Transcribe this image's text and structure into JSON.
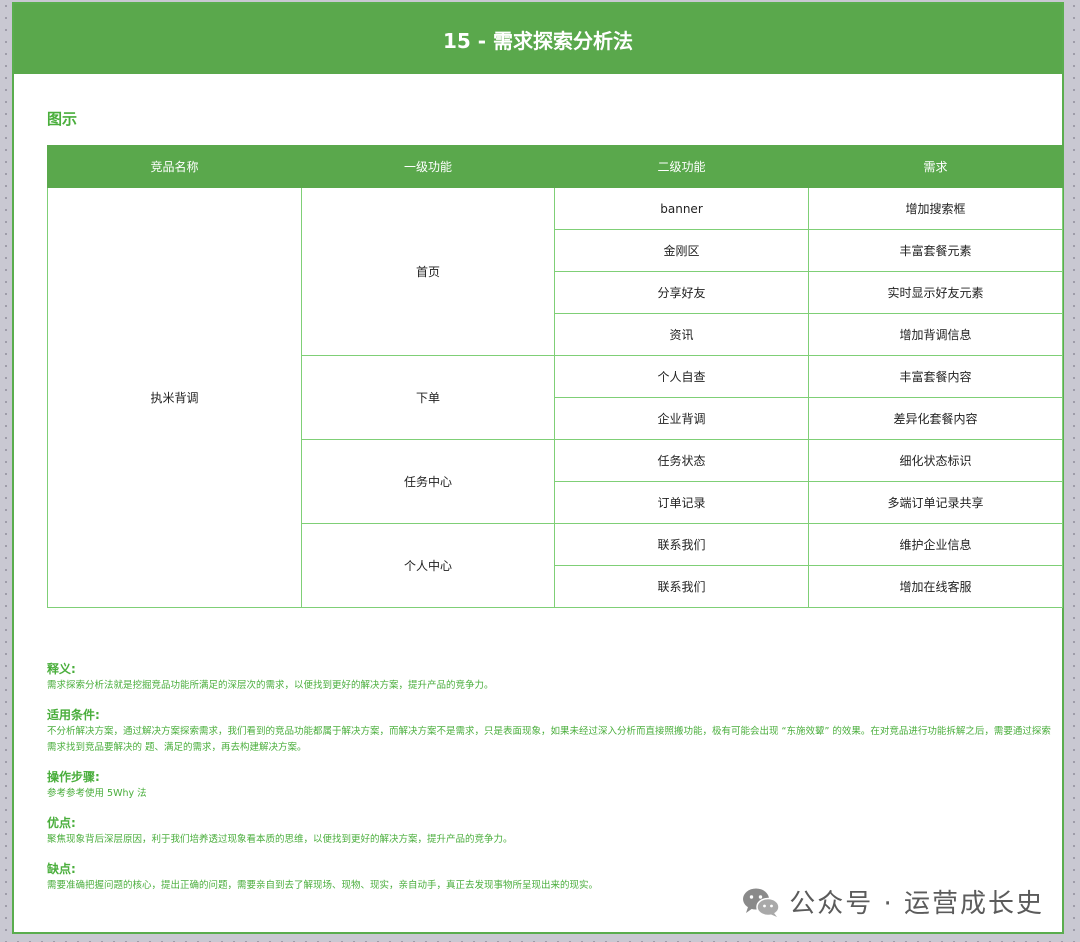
{
  "header": {
    "title": "15 - 需求探索分析法"
  },
  "section": {
    "title": "图示"
  },
  "table": {
    "headers": [
      "竞品名称",
      "一级功能",
      "二级功能",
      "需求"
    ],
    "product": "执米背调",
    "groups": [
      {
        "level1": "首页",
        "rows": [
          {
            "level2": "banner",
            "need": "增加搜索框"
          },
          {
            "level2": "金刚区",
            "need": "丰富套餐元素"
          },
          {
            "level2": "分享好友",
            "need": "实时显示好友元素"
          },
          {
            "level2": "资讯",
            "need": "增加背调信息"
          }
        ]
      },
      {
        "level1": "下单",
        "rows": [
          {
            "level2": "个人自查",
            "need": "丰富套餐内容"
          },
          {
            "level2": "企业背调",
            "need": "差异化套餐内容"
          }
        ]
      },
      {
        "level1": "任务中心",
        "rows": [
          {
            "level2": "任务状态",
            "need": "细化状态标识"
          },
          {
            "level2": "订单记录",
            "need": "多端订单记录共享"
          }
        ]
      },
      {
        "level1": "个人中心",
        "rows": [
          {
            "level2": "联系我们",
            "need": "维护企业信息"
          },
          {
            "level2": "联系我们",
            "need": "增加在线客服"
          }
        ]
      }
    ]
  },
  "notes": {
    "definition": {
      "title": "释义:",
      "body": "需求探索分析法就是挖掘竞品功能所满足的深层次的需求，以便找到更好的解决方案，提升产品的竞争力。"
    },
    "conditions": {
      "title": "适用条件:",
      "body": "不分析解决方案，通过解决方案探索需求，我们看到的竞品功能都属于解决方案，而解决方案不是需求，只是表面现象，如果未经过深入分析而直接照搬功能，极有可能会出现 “东施效颦” 的效果。在对竞品进行功能拆解之后，需要通过探索需求找到竞品要解决的 题、满足的需求，再去构建解决方案。"
    },
    "steps": {
      "title": "操作步骤:",
      "body": "参考参考使用 5Why 法"
    },
    "pros": {
      "title": "优点:",
      "body": "聚焦现象背后深层原因，利于我们培养透过现象看本质的思维，以便找到更好的解决方案，提升产品的竞争力。"
    },
    "cons": {
      "title": "缺点:",
      "body": "需要准确把握问题的核心，提出正确的问题，需要亲自到去了解现场、现物、现实，亲自动手，真正去发现事物所呈现出来的现实。"
    }
  },
  "watermark": {
    "text": "公众号 · 运营成长史",
    "icon": "wechat-icon"
  },
  "colors": {
    "brand_green": "#5aa84c",
    "text_green": "#4aae3c",
    "border_green": "#7fcf76"
  }
}
